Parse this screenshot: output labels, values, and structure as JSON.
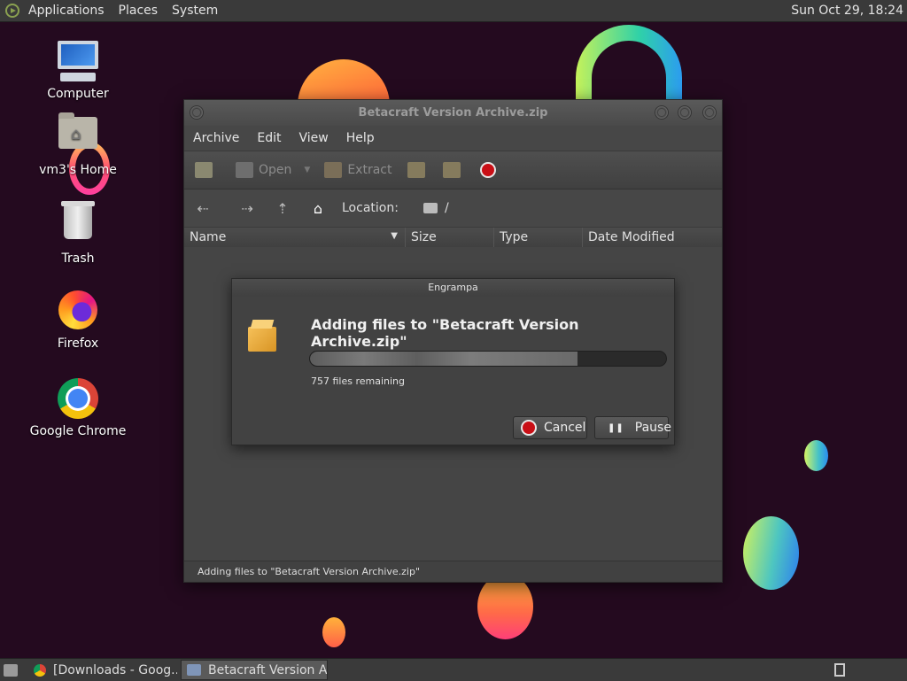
{
  "top_panel": {
    "menus": [
      "Applications",
      "Places",
      "System"
    ],
    "clock": "Sun Oct 29, 18:24"
  },
  "desktop": {
    "icons": [
      "Computer",
      "vm3's Home",
      "Trash",
      "Firefox",
      "Google Chrome"
    ]
  },
  "window": {
    "title": "Betacraft Version Archive.zip",
    "menu": [
      "Archive",
      "Edit",
      "View",
      "Help"
    ],
    "toolbar": {
      "open": "Open",
      "extract": "Extract"
    },
    "location_label": "Location:",
    "location_value": "/",
    "columns": [
      "Name",
      "Size",
      "Type",
      "Date Modified"
    ],
    "status": "Adding files to \"Betacraft Version Archive.zip\""
  },
  "dialog": {
    "title": "Engrampa",
    "heading": "Adding files to \"Betacraft Version Archive.zip\"",
    "remaining": "757 files remaining",
    "progress": 0.75,
    "cancel": "Cancel",
    "pause": "Pause"
  },
  "taskbar": {
    "tasks": [
      "[Downloads - Goog...",
      "Betacraft Version Ar..."
    ]
  },
  "colors": {
    "accent_stop": "#c90f16",
    "window_bg": "#474747",
    "panel_bg": "#3a3a3a"
  }
}
